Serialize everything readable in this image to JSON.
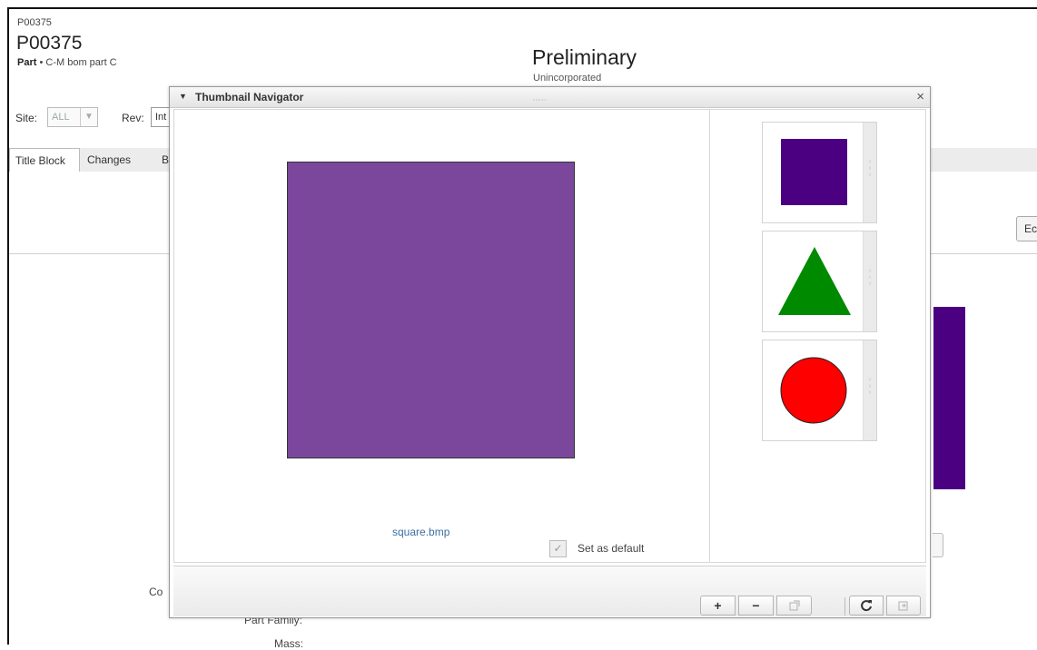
{
  "header": {
    "breadcrumb": "P00375",
    "title": "P00375",
    "type_label": "Part",
    "bullet": "•",
    "description": "C-M bom part C",
    "status": "Preliminary",
    "substatus": "Unincorporated"
  },
  "filters": {
    "site_label": "Site:",
    "site_value": "ALL",
    "rev_label": "Rev:",
    "rev_value": "Int"
  },
  "tabs": [
    {
      "label": "Title Block",
      "active": true
    },
    {
      "label": "Changes",
      "active": false
    },
    {
      "label": "B",
      "active": false
    }
  ],
  "background": {
    "edit_label": "Ec",
    "field_labels": [
      "Co",
      "Part Family:",
      "Mass:"
    ],
    "shape_color": "#4b0082"
  },
  "dialog": {
    "title": "Thumbnail Navigator",
    "close_glyph": "×",
    "toggle_glyph": "▼",
    "grip": "▫▫▫▫▫",
    "preview": {
      "filename": "square.bmp",
      "color": "#7b479d",
      "set_default_label": "Set as default",
      "set_default_checked": true
    },
    "thumbnails": [
      {
        "name": "square",
        "color": "#4b0082"
      },
      {
        "name": "triangle",
        "color": "#008a00"
      },
      {
        "name": "circle",
        "color": "#ff0000"
      }
    ],
    "footer": {
      "zoom_in": "+",
      "zoom_out": "−",
      "fit_icon": "fit-icon",
      "refresh_icon": "refresh-icon",
      "rotate_icon": "rotate-icon"
    }
  }
}
